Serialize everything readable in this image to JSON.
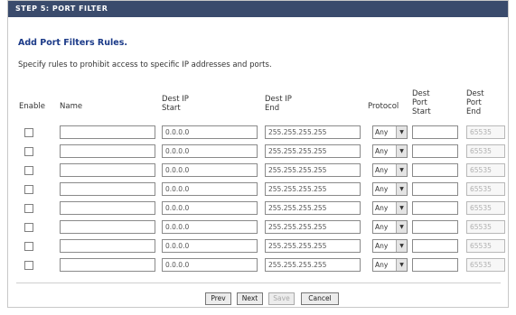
{
  "header": {
    "title": "STEP 5: PORT FILTER"
  },
  "section": {
    "title": "Add Port Filters Rules.",
    "description": "Specify rules to prohibit access to specific IP addresses and ports."
  },
  "columns": {
    "enable": "Enable",
    "name": "Name",
    "dest_ip_start": [
      "Dest IP",
      "Start"
    ],
    "dest_ip_end": [
      "Dest IP",
      "End"
    ],
    "protocol": "Protocol",
    "dest_port_start": [
      "Dest",
      "Port",
      "Start"
    ],
    "dest_port_end": [
      "Dest",
      "Port",
      "End"
    ]
  },
  "rows": [
    {
      "enabled": false,
      "name": "",
      "ip_start": "0.0.0.0",
      "ip_end": "255.255.255.255",
      "protocol": "Any",
      "port_start": "",
      "port_end": "65535"
    },
    {
      "enabled": false,
      "name": "",
      "ip_start": "0.0.0.0",
      "ip_end": "255.255.255.255",
      "protocol": "Any",
      "port_start": "",
      "port_end": "65535"
    },
    {
      "enabled": false,
      "name": "",
      "ip_start": "0.0.0.0",
      "ip_end": "255.255.255.255",
      "protocol": "Any",
      "port_start": "",
      "port_end": "65535"
    },
    {
      "enabled": false,
      "name": "",
      "ip_start": "0.0.0.0",
      "ip_end": "255.255.255.255",
      "protocol": "Any",
      "port_start": "",
      "port_end": "65535"
    },
    {
      "enabled": false,
      "name": "",
      "ip_start": "0.0.0.0",
      "ip_end": "255.255.255.255",
      "protocol": "Any",
      "port_start": "",
      "port_end": "65535"
    },
    {
      "enabled": false,
      "name": "",
      "ip_start": "0.0.0.0",
      "ip_end": "255.255.255.255",
      "protocol": "Any",
      "port_start": "",
      "port_end": "65535"
    },
    {
      "enabled": false,
      "name": "",
      "ip_start": "0.0.0.0",
      "ip_end": "255.255.255.255",
      "protocol": "Any",
      "port_start": "",
      "port_end": "65535"
    },
    {
      "enabled": false,
      "name": "",
      "ip_start": "0.0.0.0",
      "ip_end": "255.255.255.255",
      "protocol": "Any",
      "port_start": "",
      "port_end": "65535"
    }
  ],
  "buttons": {
    "prev": "Prev",
    "next": "Next",
    "save": "Save",
    "cancel": "Cancel"
  },
  "colors": {
    "header_bg": "#3a4b6c",
    "title": "#1b3a88"
  }
}
